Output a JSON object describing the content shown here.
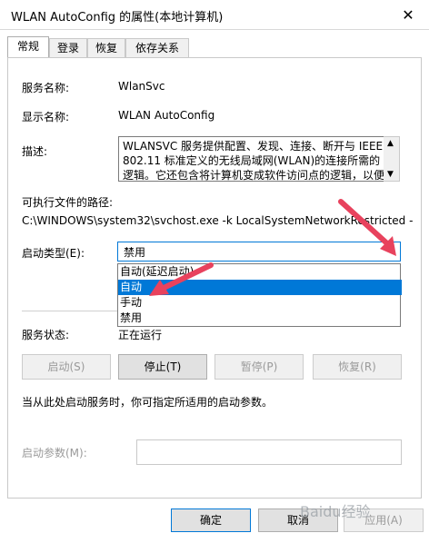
{
  "window": {
    "title": "WLAN AutoConfig 的属性(本地计算机)",
    "close": "✕"
  },
  "tabs": [
    {
      "label": "常规"
    },
    {
      "label": "登录"
    },
    {
      "label": "恢复"
    },
    {
      "label": "依存关系"
    }
  ],
  "general": {
    "service_name_label": "服务名称:",
    "service_name_value": "WlanSvc",
    "display_name_label": "显示名称:",
    "display_name_value": "WLAN AutoConfig",
    "desc_label": "描述:",
    "desc_value": "WLANSVC 服务提供配置、发现、连接、断开与 IEEE 802.11 标准定义的无线局域网(WLAN)的连接所需的逻辑。它还包含将计算机变成软件访问点的逻辑，以便",
    "path_label": "可执行文件的路径:",
    "path_value": "C:\\WINDOWS\\system32\\svchost.exe -k LocalSystemNetworkRestricted -",
    "startup_label": "启动类型(E):",
    "startup_value": "禁用",
    "startup_options": [
      {
        "label": "自动(延迟启动)"
      },
      {
        "label": "自动"
      },
      {
        "label": "手动"
      },
      {
        "label": "禁用"
      }
    ],
    "status_label": "服务状态:",
    "status_value": "正在运行",
    "buttons": {
      "start": "启动(S)",
      "stop": "停止(T)",
      "pause": "暂停(P)",
      "resume": "恢复(R)"
    },
    "hint": "当从此处启动服务时，你可指定所适用的启动参数。",
    "param_label": "启动参数(M):",
    "param_value": ""
  },
  "footer": {
    "ok": "确定",
    "cancel": "取消",
    "apply": "应用(A)"
  },
  "watermark": "Baidu经验",
  "colors": {
    "accent": "#0078d7",
    "annotation": "#e8425d"
  }
}
